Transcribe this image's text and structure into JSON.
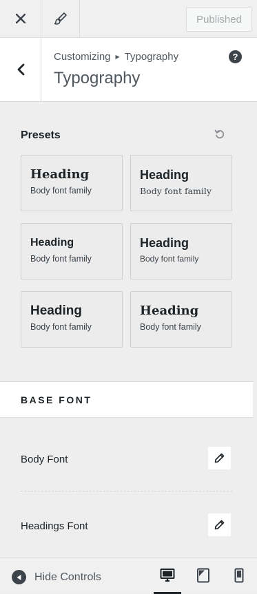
{
  "topbar": {
    "close_icon": "close-icon",
    "brush_icon": "paint-brush-icon",
    "publish_label": "Published"
  },
  "header": {
    "back_icon": "chevron-left-icon",
    "breadcrumb_root": "Customizing",
    "breadcrumb_current": "Typography",
    "title": "Typography",
    "help_label": "?"
  },
  "presets": {
    "label": "Presets",
    "reset_icon": "reset-icon",
    "items": [
      {
        "heading": "Heading",
        "body": "Body font family"
      },
      {
        "heading": "Heading",
        "body": "Body font family"
      },
      {
        "heading": "Heading",
        "body": "Body font family"
      },
      {
        "heading": "Heading",
        "body": "Body font family"
      },
      {
        "heading": "Heading",
        "body": "Body font family"
      },
      {
        "heading": "Heading",
        "body": "Body font family"
      }
    ]
  },
  "base_font": {
    "title": "BASE FONT",
    "rows": [
      {
        "label": "Body Font",
        "icon": "pencil-icon"
      },
      {
        "label": "Headings Font",
        "icon": "pencil-icon"
      }
    ]
  },
  "footer": {
    "hide_label": "Hide Controls",
    "devices": [
      "desktop-icon",
      "tablet-icon",
      "mobile-icon"
    ],
    "active_device": "desktop-icon"
  }
}
